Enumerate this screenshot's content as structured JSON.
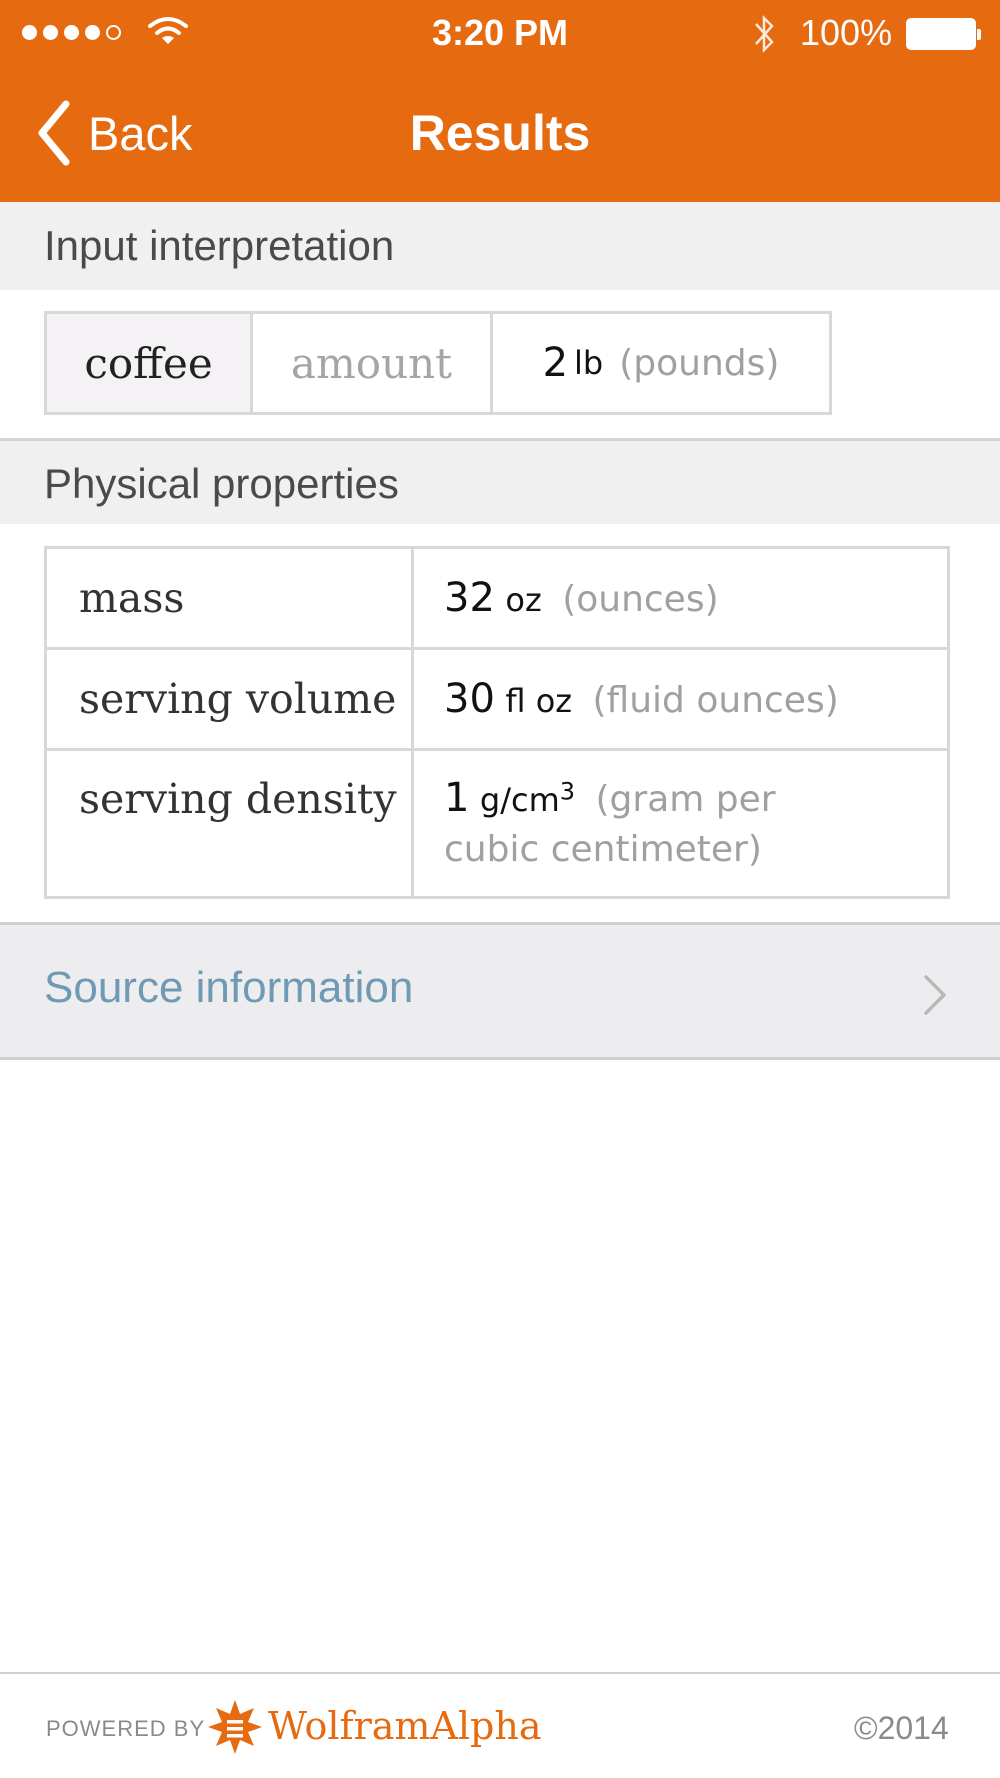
{
  "status_bar": {
    "time": "3:20 PM",
    "battery": "100%",
    "signal_dots_filled": 4,
    "signal_dots_total": 5
  },
  "nav": {
    "back_label": "Back",
    "title": "Results"
  },
  "sections": {
    "input_title": "Input interpretation",
    "physical_title": "Physical properties"
  },
  "input_interpretation": {
    "item": "coffee",
    "property": "amount",
    "value": "2",
    "unit": "lb",
    "unit_full": "(pounds)"
  },
  "physical_properties": [
    {
      "label": "mass",
      "value": "32",
      "unit": "oz",
      "unit_full": "(ounces)"
    },
    {
      "label": "serving volume",
      "value": "30",
      "unit": "fl oz",
      "unit_full": "(fluid ounces)"
    },
    {
      "label": "serving density",
      "value": "1",
      "unit": "g/cm",
      "unit_sup": "3",
      "unit_full_line1": "(gram per",
      "unit_full_line2": "cubic centimeter)"
    }
  ],
  "source": {
    "label": "Source information"
  },
  "footer": {
    "powered_by": "POWERED BY",
    "brand": "WolframAlpha",
    "copyright": "©2014"
  },
  "colors": {
    "brand_orange": "#e56a10",
    "source_link": "#6e9ab3"
  }
}
